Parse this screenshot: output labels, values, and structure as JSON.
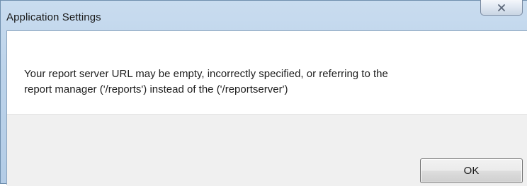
{
  "window": {
    "title": "Application Settings",
    "close_icon": "close-icon"
  },
  "dialog": {
    "message": "Your report server URL may be empty, incorrectly specified, or referring to the\nreport manager ('/reports') instead of the ('/reportserver')",
    "ok_label": "OK"
  },
  "colors": {
    "frame": "#bcd3ea",
    "footer": "#f0f0f0",
    "client": "#ffffff"
  }
}
